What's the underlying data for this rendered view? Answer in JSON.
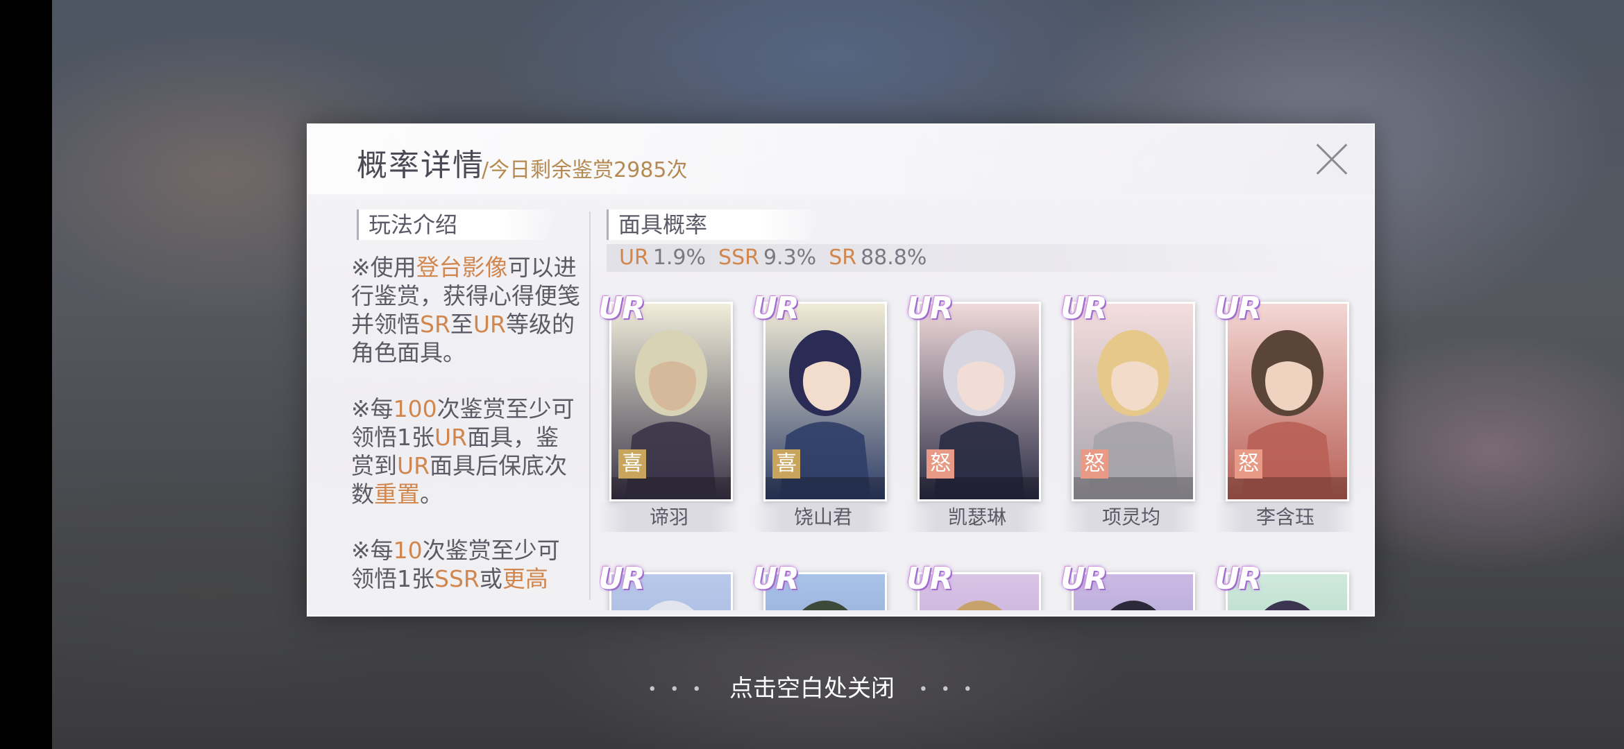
{
  "dialog": {
    "title": "概率详情",
    "remaining": "/今日剩余鉴赏2985次",
    "close_icon": "close-icon"
  },
  "rules": {
    "tab_label": "玩法介绍",
    "paragraphs": [
      [
        {
          "t": "※使用",
          "h": false
        },
        {
          "t": "登台影像",
          "h": true
        },
        {
          "t": "可以进行鉴赏，获得心得便笺并领悟",
          "h": false
        },
        {
          "t": "SR",
          "h": true
        },
        {
          "t": "至",
          "h": false
        },
        {
          "t": "UR",
          "h": true
        },
        {
          "t": "等级的角色面具。",
          "h": false
        }
      ],
      [
        {
          "t": "※每",
          "h": false
        },
        {
          "t": "100",
          "h": true
        },
        {
          "t": "次鉴赏至少可领悟1张",
          "h": false
        },
        {
          "t": "UR",
          "h": true
        },
        {
          "t": "面具，鉴赏到",
          "h": false
        },
        {
          "t": "UR",
          "h": true
        },
        {
          "t": "面具后保底次数",
          "h": false
        },
        {
          "t": "重置",
          "h": true
        },
        {
          "t": "。",
          "h": false
        }
      ],
      [
        {
          "t": "※每",
          "h": false
        },
        {
          "t": "10",
          "h": true
        },
        {
          "t": "次鉴赏至少可领悟1张",
          "h": false
        },
        {
          "t": "SSR",
          "h": true
        },
        {
          "t": "或",
          "h": false
        },
        {
          "t": "更高",
          "h": true
        }
      ]
    ]
  },
  "rates": {
    "tab_label": "面具概率",
    "items": [
      {
        "key": "UR",
        "value": "1.9%"
      },
      {
        "key": "SSR",
        "value": "9.3%"
      },
      {
        "key": "SR",
        "value": "88.8%"
      }
    ]
  },
  "cards": [
    {
      "rank": "UR",
      "emotion": "喜",
      "name": "谛羽",
      "emo_color": "#c9a45c",
      "bg_top": "#f1eedb",
      "bg_bot": "#3a3448",
      "hair": "#d9d3b6",
      "skin": "#d6b89a"
    },
    {
      "rank": "UR",
      "emotion": "喜",
      "name": "饶山君",
      "emo_color": "#c9a45c",
      "bg_top": "#f1ecd6",
      "bg_bot": "#2f3e68",
      "hair": "#2b2c55",
      "skin": "#f2dccb"
    },
    {
      "rank": "UR",
      "emotion": "怒",
      "name": "凯瑟琳",
      "emo_color": "#e89a86",
      "bg_top": "#f0dada",
      "bg_bot": "#2a2c45",
      "hair": "#d7d6e0",
      "skin": "#f1ddd6"
    },
    {
      "rank": "UR",
      "emotion": "怒",
      "name": "项灵均",
      "emo_color": "#e89a86",
      "bg_top": "#f4dddd",
      "bg_bot": "#a5a3ab",
      "hair": "#e6c98a",
      "skin": "#f2dcc9"
    },
    {
      "rank": "UR",
      "emotion": "怒",
      "name": "李含珏",
      "emo_color": "#e89a86",
      "bg_top": "#f3d7d4",
      "bg_bot": "#b85f55",
      "hair": "#5a4538",
      "skin": "#efd3c0"
    },
    {
      "rank": "UR",
      "emotion": "",
      "name": "",
      "emo_color": "#c9a45c",
      "bg_top": "#b8c9ea",
      "bg_bot": "#8aa0cf",
      "hair": "#e2e4ee",
      "skin": "#f2dcc9"
    },
    {
      "rank": "UR",
      "emotion": "",
      "name": "",
      "emo_color": "#c9a45c",
      "bg_top": "#a9c2e8",
      "bg_bot": "#6f89bb",
      "hair": "#3c4a3a",
      "skin": "#f2dcc9"
    },
    {
      "rank": "UR",
      "emotion": "",
      "name": "",
      "emo_color": "#c9a45c",
      "bg_top": "#d9c4e6",
      "bg_bot": "#a98fc5",
      "hair": "#c7a36b",
      "skin": "#f2dcc9"
    },
    {
      "rank": "UR",
      "emotion": "",
      "name": "",
      "emo_color": "#c9a45c",
      "bg_top": "#c9b9e3",
      "bg_bot": "#9585c0",
      "hair": "#2c2a3a",
      "skin": "#f2dcc9"
    },
    {
      "rank": "UR",
      "emotion": "",
      "name": "",
      "emo_color": "#c9a45c",
      "bg_top": "#cfe9dc",
      "bg_bot": "#8fc2a8",
      "hair": "#3b3552",
      "skin": "#f2dcc9"
    }
  ],
  "footer": {
    "dismiss_text": "点击空白处关闭"
  }
}
